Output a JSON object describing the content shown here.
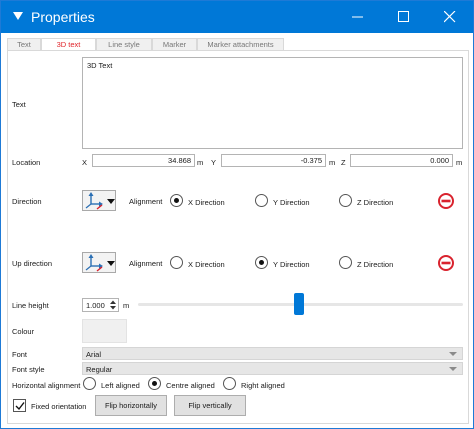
{
  "window": {
    "title": "Properties",
    "minimize_icon": "minimize-icon",
    "maximize_icon": "maximize-icon",
    "close_icon": "close-icon",
    "title_bar_color": "#0078d7"
  },
  "tabs": [
    {
      "label": "Text",
      "active": false
    },
    {
      "label": "3D text",
      "active": true
    },
    {
      "label": "Line style",
      "active": false
    },
    {
      "label": "Marker",
      "active": false
    },
    {
      "label": "Marker attachments",
      "active": false
    }
  ],
  "text_section": {
    "label": "Text",
    "value": "3D Text"
  },
  "location": {
    "label": "Location",
    "x_label": "X",
    "x_value": "34.868",
    "x_unit": "m",
    "y_label": "Y",
    "y_value": "-0.375",
    "y_unit": "m",
    "z_label": "Z",
    "z_value": "0.000",
    "z_unit": "m"
  },
  "direction": {
    "label": "Direction",
    "alignment_label": "Alignment",
    "options": [
      "X Direction",
      "Y Direction",
      "Z Direction"
    ],
    "selected": "X Direction"
  },
  "up_direction": {
    "label": "Up direction",
    "alignment_label": "Alignment",
    "options": [
      "X Direction",
      "Y Direction",
      "Z Direction"
    ],
    "selected": "Y Direction"
  },
  "line_height": {
    "label": "Line height",
    "value": "1.000",
    "unit": "m"
  },
  "colour": {
    "label": "Colour",
    "swatch": "#f0f0f0"
  },
  "font": {
    "label": "Font",
    "value": "Arial"
  },
  "font_style": {
    "label": "Font style",
    "value": "Regular"
  },
  "horizontal_alignment": {
    "label": "Horizontal alignment",
    "options": [
      "Left aligned",
      "Centre aligned",
      "Right aligned"
    ],
    "selected": "Centre aligned"
  },
  "fixed_orientation": {
    "label": "Fixed orientation",
    "checked": true
  },
  "buttons": {
    "flip_h": "Flip horizontally",
    "flip_v": "Flip vertically"
  },
  "accent": {
    "active_tab": "#e0252b",
    "remove": "#d9232e",
    "slider": "#0078d7"
  }
}
